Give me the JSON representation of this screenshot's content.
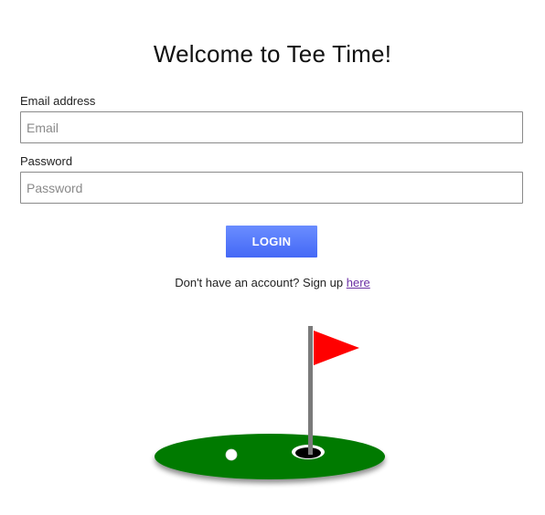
{
  "header": {
    "title": "Welcome to Tee Time!"
  },
  "form": {
    "email_label": "Email address",
    "email_placeholder": "Email",
    "email_value": "",
    "password_label": "Password",
    "password_placeholder": "Password",
    "password_value": "",
    "login_label": "LOGIN"
  },
  "signup": {
    "prompt": "Don't have an account? Sign up ",
    "link_text": "here"
  },
  "illustration": {
    "name": "golf-green",
    "colors": {
      "green": "#007a00",
      "flag": "#ff0000",
      "pole": "#7a7a7a",
      "ball": "#ffffff",
      "hole": "#000000"
    }
  },
  "colors": {
    "button_gradient_top": "#6a8dff",
    "button_gradient_bottom": "#4468f6",
    "link": "#6b2fa3",
    "input_border": "#8a8a8a"
  }
}
